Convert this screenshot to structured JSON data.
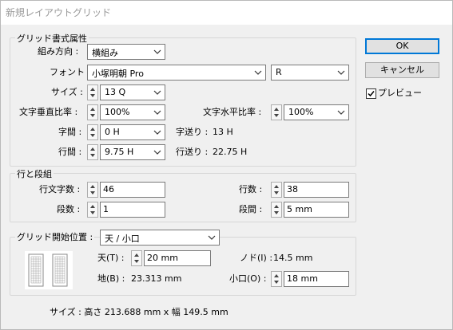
{
  "window": {
    "title": "新規レイアウトグリッド"
  },
  "buttons": {
    "ok": "OK",
    "cancel": "キャンセル"
  },
  "preview": {
    "label": "プレビュー",
    "checked": true
  },
  "grid_attributes": {
    "title": "グリッド書式属性",
    "direction": {
      "label": "組み方向 :",
      "value": "横組み"
    },
    "font": {
      "label": "フォント :",
      "value": "小塚明朝 Pro",
      "style": "R"
    },
    "size": {
      "label": "サイズ :",
      "value": "13 Q"
    },
    "vertical_ratio": {
      "label": "文字垂直比率 :",
      "value": "100%"
    },
    "horizontal_ratio": {
      "label": "文字水平比率 :",
      "value": "100%"
    },
    "char_spacing": {
      "label": "字間 :",
      "value": "0 H"
    },
    "char_aki": {
      "label": "字送り :",
      "value": "13 H"
    },
    "line_spacing": {
      "label": "行間 :",
      "value": "9.75 H"
    },
    "line_feed": {
      "label": "行送り :",
      "value": "22.75 H"
    }
  },
  "lines_columns": {
    "title": "行と段組",
    "chars_per_line": {
      "label": "行文字数 :",
      "value": "46"
    },
    "lines": {
      "label": "行数 :",
      "value": "38"
    },
    "columns": {
      "label": "段数 :",
      "value": "1"
    },
    "gutter": {
      "label": "段間 :",
      "value": "5 mm"
    }
  },
  "grid_start": {
    "label": "グリッド開始位置 :",
    "value": "天 / 小口",
    "top": {
      "label": "天(T) :",
      "value": "20 mm"
    },
    "nodo": {
      "label": "ノド(I) :",
      "value": "14.5 mm"
    },
    "bottom": {
      "label": "地(B) :",
      "value": "23.313 mm"
    },
    "fore_edge": {
      "label": "小口(O) :",
      "value": "18 mm"
    }
  },
  "status": {
    "size_text": "サイズ : 高さ 213.688 mm x 幅 149.5 mm"
  }
}
